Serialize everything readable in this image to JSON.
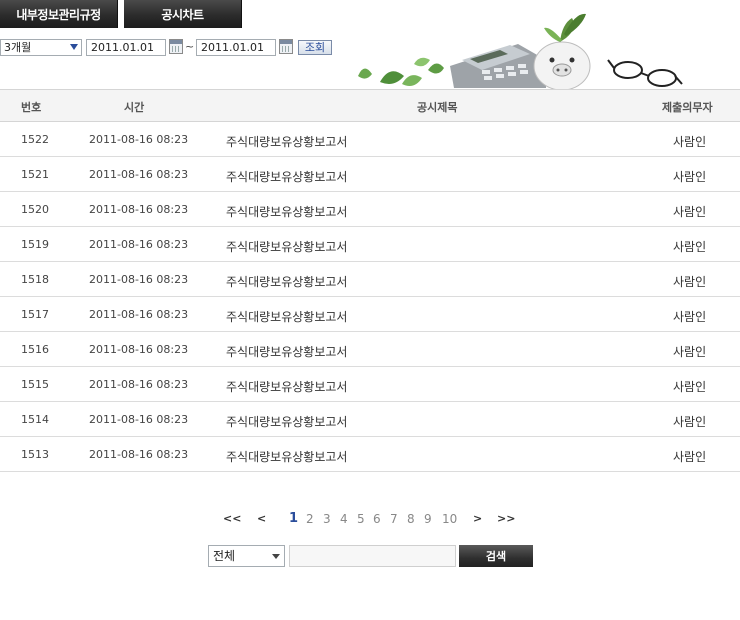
{
  "top_buttons": {
    "internal_rules": "내부정보관리규정",
    "disclosure_chart": "공시차트"
  },
  "filter": {
    "period": "3개월",
    "date_from": "2011.01.01",
    "separator": "~",
    "date_to": "2011.01.01",
    "search_label": "조회"
  },
  "table": {
    "headers": {
      "no": "번호",
      "time": "시간",
      "title": "공시제목",
      "submitter": "제출의무자"
    },
    "rows": [
      {
        "no": "1522",
        "time": "2011-08-16 08:23",
        "title": "주식대량보유상황보고서",
        "submitter": "사람인"
      },
      {
        "no": "1521",
        "time": "2011-08-16 08:23",
        "title": "주식대량보유상황보고서",
        "submitter": "사람인"
      },
      {
        "no": "1520",
        "time": "2011-08-16 08:23",
        "title": "주식대량보유상황보고서",
        "submitter": "사람인"
      },
      {
        "no": "1519",
        "time": "2011-08-16 08:23",
        "title": "주식대량보유상황보고서",
        "submitter": "사람인"
      },
      {
        "no": "1518",
        "time": "2011-08-16 08:23",
        "title": "주식대량보유상황보고서",
        "submitter": "사람인"
      },
      {
        "no": "1517",
        "time": "2011-08-16 08:23",
        "title": "주식대량보유상황보고서",
        "submitter": "사람인"
      },
      {
        "no": "1516",
        "time": "2011-08-16 08:23",
        "title": "주식대량보유상황보고서",
        "submitter": "사람인"
      },
      {
        "no": "1515",
        "time": "2011-08-16 08:23",
        "title": "주식대량보유상황보고서",
        "submitter": "사람인"
      },
      {
        "no": "1514",
        "time": "2011-08-16 08:23",
        "title": "주식대량보유상황보고서",
        "submitter": "사람인"
      },
      {
        "no": "1513",
        "time": "2011-08-16 08:23",
        "title": "주식대량보유상황보고서",
        "submitter": "사람인"
      }
    ]
  },
  "pagination": {
    "first": "<<",
    "prev": "<",
    "pages": [
      "1",
      "2",
      "3",
      "4",
      "5",
      "6",
      "7",
      "8",
      "9",
      "10"
    ],
    "current": "1",
    "next": ">",
    "last": ">>"
  },
  "search": {
    "scope": "전체",
    "button": "검색"
  },
  "colors": {
    "accent": "#2a4d9b",
    "button_dark": "#2b2b2b"
  }
}
